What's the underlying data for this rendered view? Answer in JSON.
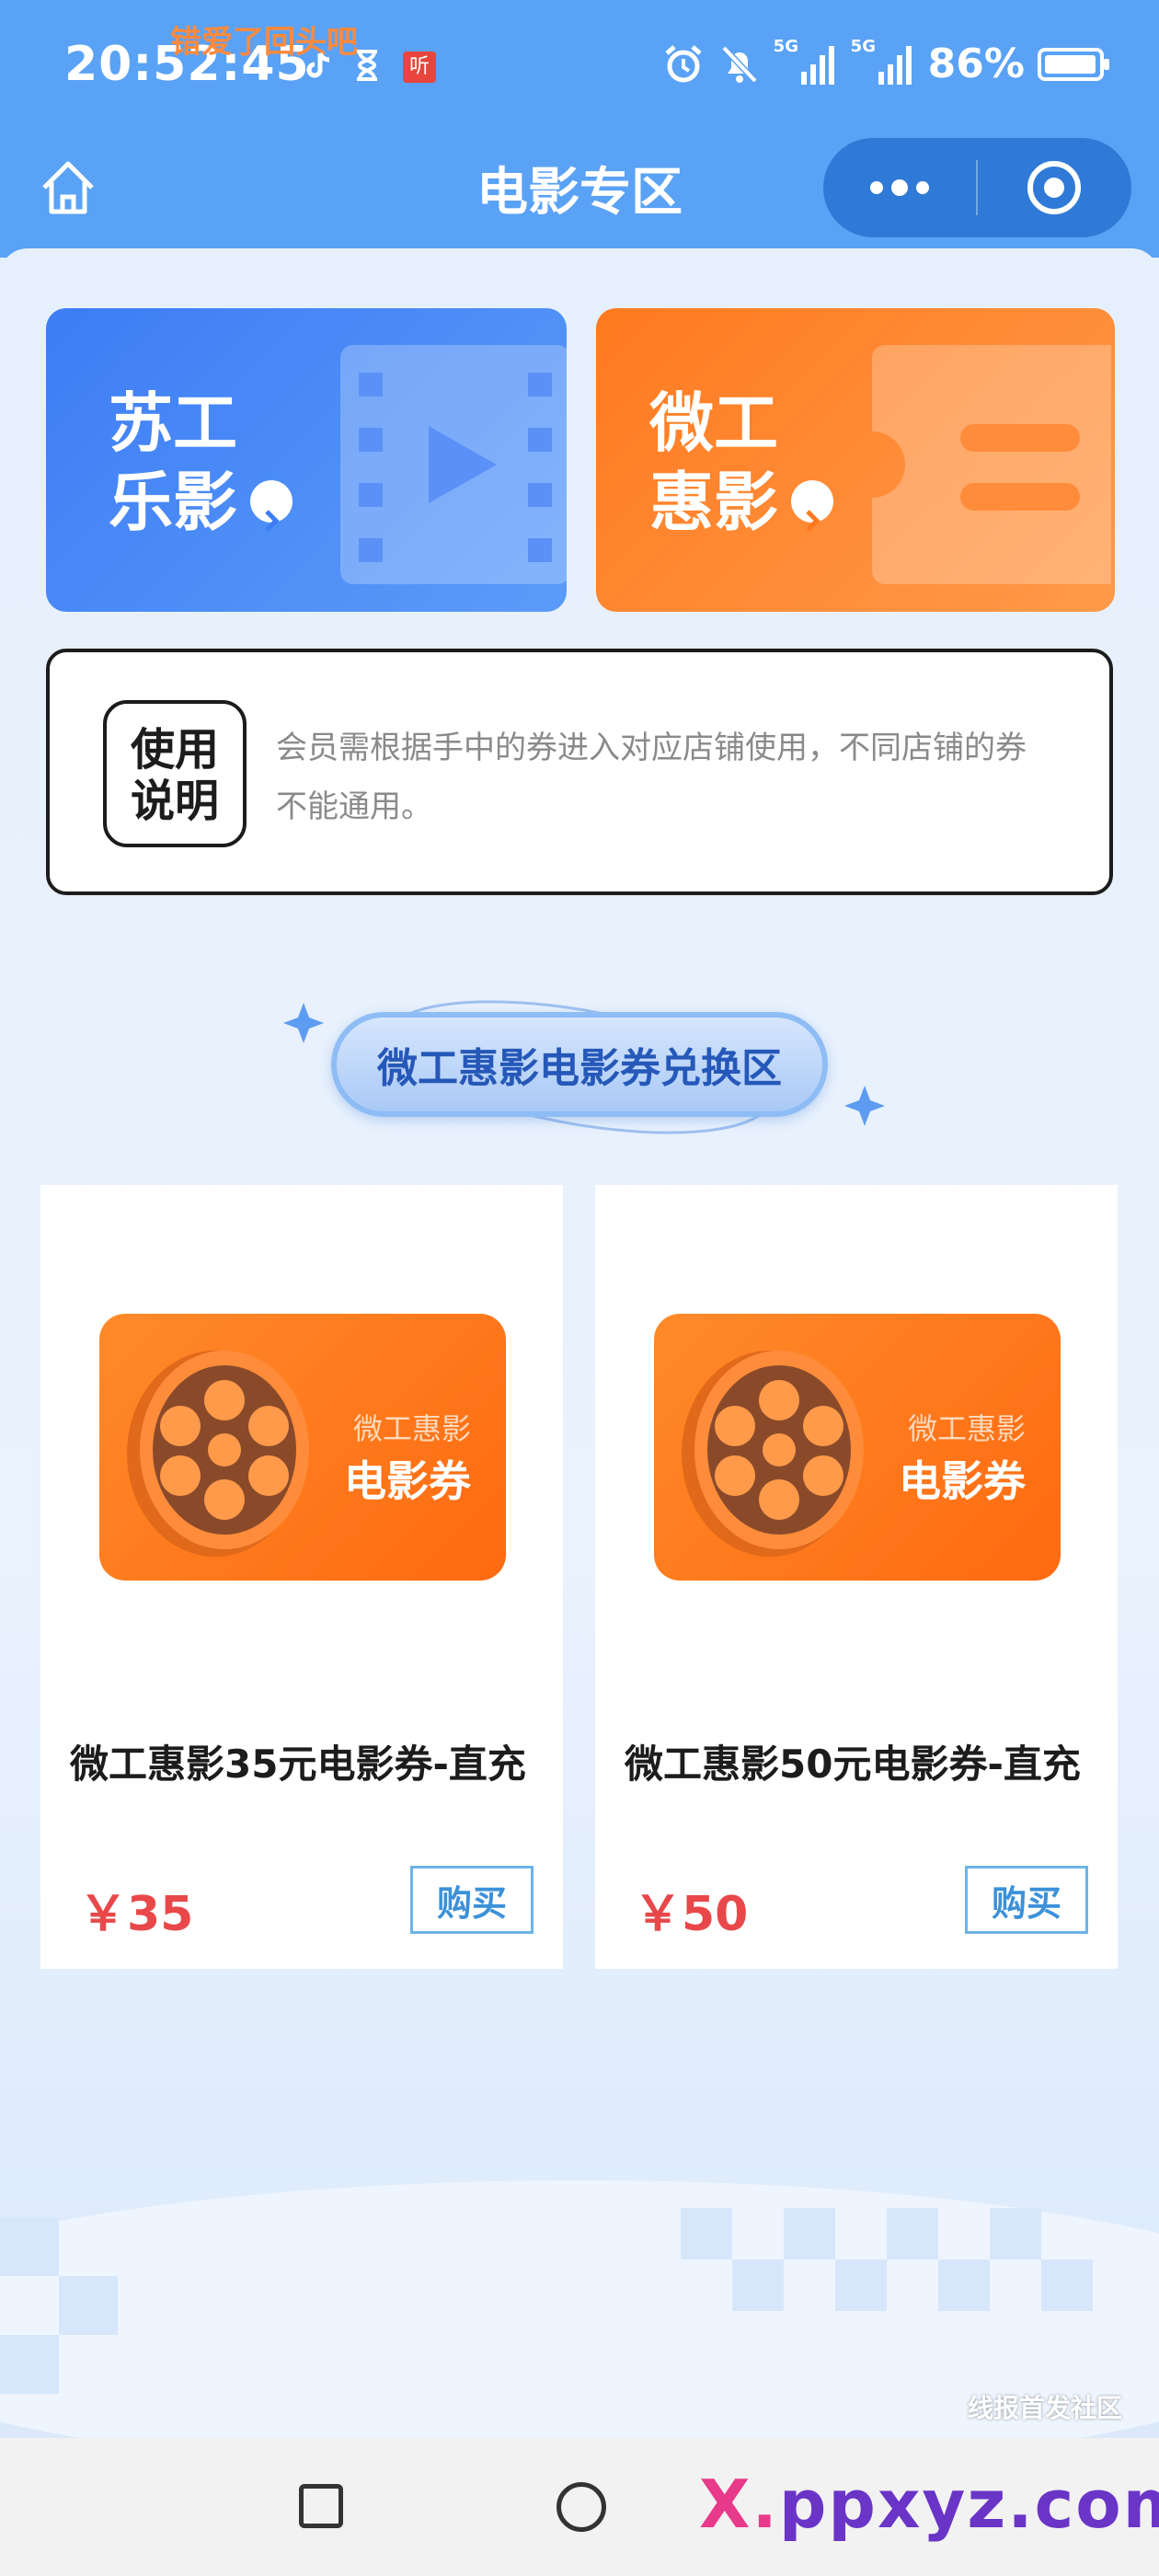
{
  "status_bar": {
    "time": "20:52:45",
    "notification_text": "错爱了回头吧",
    "listen_badge": "听",
    "battery": "86%",
    "signal_labels": [
      "5G",
      "5G"
    ]
  },
  "nav": {
    "title": "电影专区"
  },
  "banners": [
    {
      "line1": "苏工",
      "line2": "乐影",
      "color": "#3d7df5"
    },
    {
      "line1": "微工",
      "line2": "惠影",
      "color": "#ff7a1f"
    }
  ],
  "usage": {
    "tag_line1": "使用",
    "tag_line2": "说明",
    "text": "会员需根据手中的券进入对应店铺使用，不同店铺的券不能通用。"
  },
  "section": {
    "title": "微工惠影电影券兑换区"
  },
  "products": [
    {
      "img_sub": "微工惠影",
      "img_main": "电影券",
      "title": "微工惠影35元电影券-直充",
      "price": "￥35",
      "buy_label": "购买"
    },
    {
      "img_sub": "微工惠影",
      "img_main": "电影券",
      "title": "微工惠影50元电影券-直充",
      "price": "￥50",
      "buy_label": "购买"
    }
  ],
  "watermark": {
    "forum": "线报首发社区",
    "site_prefix": "X.",
    "site": "ppxyz.com"
  }
}
